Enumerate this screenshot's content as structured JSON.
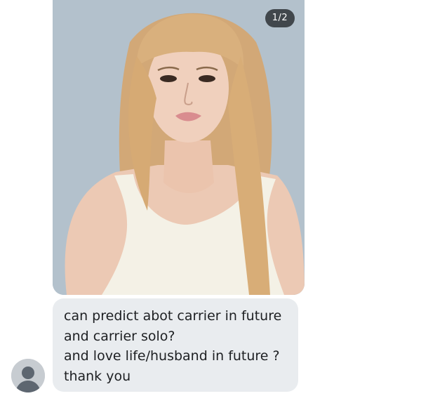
{
  "attachment": {
    "counter": "1/2",
    "icon": "photo-attachment"
  },
  "message": {
    "lines": [
      "can predict abot carrier in future",
      "and carrier solo?",
      "and love life/husband in future ?",
      "thank you"
    ],
    "bubble_color": "#e9ecef"
  },
  "sender": {
    "avatar_icon": "default-user-icon"
  }
}
